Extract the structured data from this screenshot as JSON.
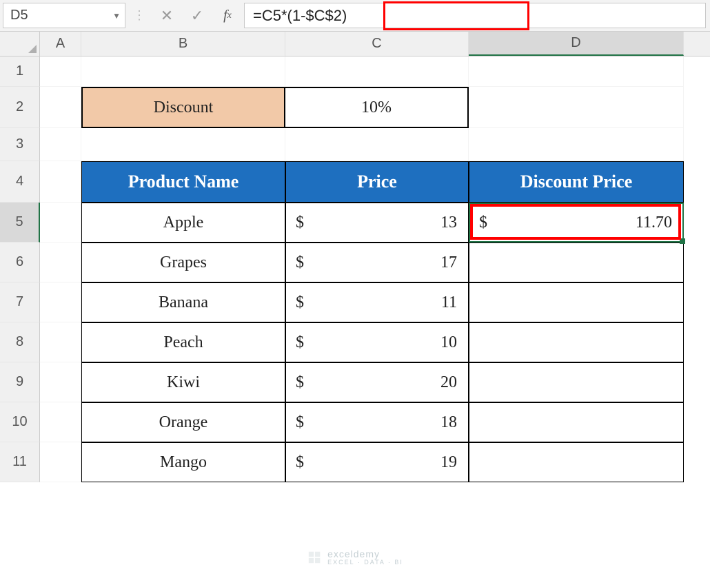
{
  "nameBox": "D5",
  "formula": "=C5*(1-$C$2)",
  "columns": [
    "A",
    "B",
    "C",
    "D"
  ],
  "rowNumbers": [
    1,
    2,
    3,
    4,
    5,
    6,
    7,
    8,
    9,
    10,
    11
  ],
  "selectedColumn": "D",
  "selectedRow": 5,
  "discount": {
    "label": "Discount",
    "value": "10%"
  },
  "table": {
    "headers": {
      "product": "Product Name",
      "price": "Price",
      "discount": "Discount Price"
    },
    "currency": "$",
    "rows": [
      {
        "product": "Apple",
        "price": "13",
        "discountPrice": "11.70"
      },
      {
        "product": "Grapes",
        "price": "17",
        "discountPrice": ""
      },
      {
        "product": "Banana",
        "price": "11",
        "discountPrice": ""
      },
      {
        "product": "Peach",
        "price": "10",
        "discountPrice": ""
      },
      {
        "product": "Kiwi",
        "price": "20",
        "discountPrice": ""
      },
      {
        "product": "Orange",
        "price": "18",
        "discountPrice": ""
      },
      {
        "product": "Mango",
        "price": "19",
        "discountPrice": ""
      }
    ]
  },
  "watermark": {
    "brand": "exceldemy",
    "tagline": "EXCEL · DATA · BI"
  }
}
